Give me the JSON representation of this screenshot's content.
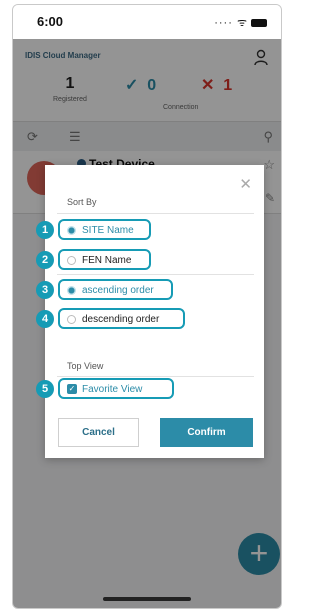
{
  "status_bar": {
    "time": "6:00",
    "icons": "···· ᯤ"
  },
  "app": {
    "title": "IDIS Cloud Manager",
    "stats": [
      {
        "value": "1",
        "label": "Registered",
        "color": "#222222"
      },
      {
        "value": "0",
        "label": "",
        "color": "#2c8ca8",
        "mark": "✓"
      },
      {
        "value": "1",
        "label": "Connection",
        "color": "#d9342b",
        "mark": "✕"
      }
    ]
  },
  "device": {
    "name": "Test Device"
  },
  "dialog": {
    "sort_by_label": "Sort By",
    "options": [
      {
        "label": "SITE Name",
        "selected": true,
        "badge": "1"
      },
      {
        "label": "FEN Name",
        "selected": false,
        "badge": "2"
      },
      {
        "label": "ascending order",
        "selected": true,
        "badge": "3"
      },
      {
        "label": "descending order",
        "selected": false,
        "badge": "4"
      }
    ],
    "top_view_label": "Top View",
    "favorite": {
      "label": "Favorite View",
      "checked": true,
      "badge": "5"
    },
    "cancel_label": "Cancel",
    "confirm_label": "Confirm"
  },
  "colors": {
    "accent": "#2c8ca8",
    "highlight": "#169bb5",
    "error": "#d9342b"
  }
}
